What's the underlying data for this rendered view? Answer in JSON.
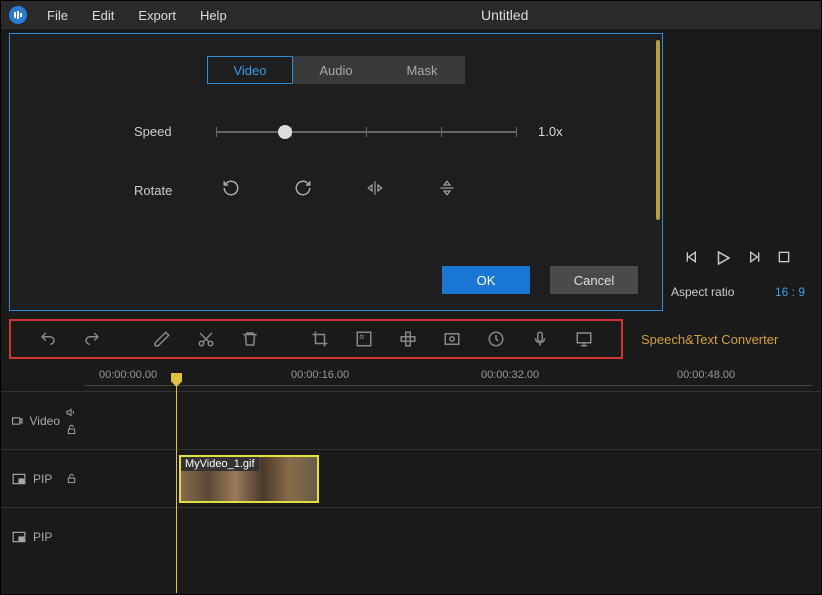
{
  "menus": {
    "file": "File",
    "edit": "Edit",
    "export": "Export",
    "help": "Help"
  },
  "title": "Untitled",
  "tabs": {
    "video": "Video",
    "audio": "Audio",
    "mask": "Mask"
  },
  "speed": {
    "label": "Speed",
    "value": "1.0x"
  },
  "rotate": {
    "label": "Rotate"
  },
  "buttons": {
    "ok": "OK",
    "cancel": "Cancel"
  },
  "aspect": {
    "label": "Aspect ratio",
    "value": "16 : 9"
  },
  "speech_text": "Speech&Text Converter",
  "timecodes": {
    "t0": "00:00:00.00",
    "t1": "00:00:16.00",
    "t2": "00:00:32.00",
    "t3": "00:00:48.00"
  },
  "tracks": {
    "video": "Video",
    "pip1": "PIP",
    "pip2": "PIP"
  },
  "clip": {
    "name": "MyVideo_1.gif"
  }
}
